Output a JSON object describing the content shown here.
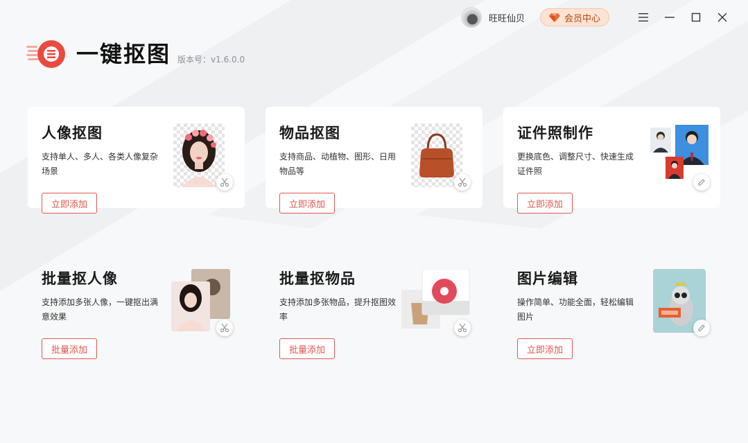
{
  "header": {
    "username": "旺旺仙贝",
    "vip_label": "会员中心"
  },
  "logo": {
    "title": "一键抠图",
    "version": "版本号：v1.6.0.0"
  },
  "cards": [
    {
      "title": "人像抠图",
      "desc": "支持单人、多人、各类人像复杂场景",
      "button": "立即添加"
    },
    {
      "title": "物品抠图",
      "desc": "支持商品、动植物、图形、日用物品等",
      "button": "立即添加"
    },
    {
      "title": "证件照制作",
      "desc": "更换底色、调整尺寸、快速生成证件照",
      "button": "立即添加"
    },
    {
      "title": "批量抠人像",
      "desc": "支持添加多张人像，一键抠出满意效果",
      "button": "批量添加"
    },
    {
      "title": "批量抠物品",
      "desc": "支持添加多张物品，提升抠图效率",
      "button": "批量添加"
    },
    {
      "title": "图片编辑",
      "desc": "操作简单、功能全面，轻松编辑图片",
      "button": "立即添加"
    }
  ],
  "colors": {
    "accent": "#e0564d",
    "vip_bg": "#fde3d3",
    "background": "#f7f8f9"
  },
  "icons": {
    "menu": "menu-icon",
    "minimize": "minimize-icon",
    "maximize": "maximize-icon",
    "close": "close-icon",
    "scissors": "scissors-icon",
    "pencil": "pencil-icon",
    "gem": "gem-icon"
  }
}
